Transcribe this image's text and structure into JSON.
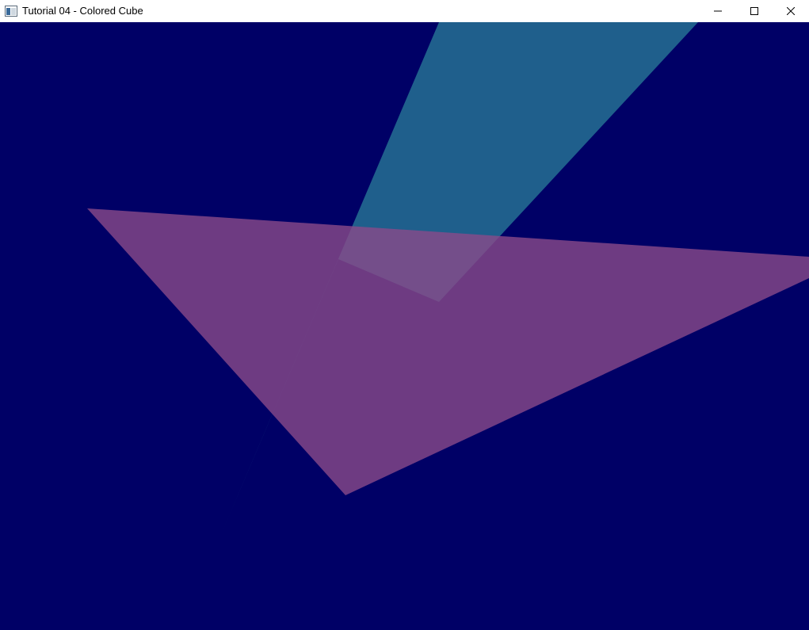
{
  "window": {
    "title": "Tutorial 04 - Colored Cube",
    "icon": "app-window-icon",
    "controls": {
      "minimize_icon": "minimize-icon",
      "maximize_icon": "maximize-icon",
      "close_icon": "close-icon"
    }
  },
  "scene": {
    "clear_color": "#000066",
    "shapes": [
      {
        "name": "cyan-triangle",
        "color": "#2a7f99"
      },
      {
        "name": "magenta-triangle",
        "color": "#8a4a8a"
      }
    ]
  }
}
